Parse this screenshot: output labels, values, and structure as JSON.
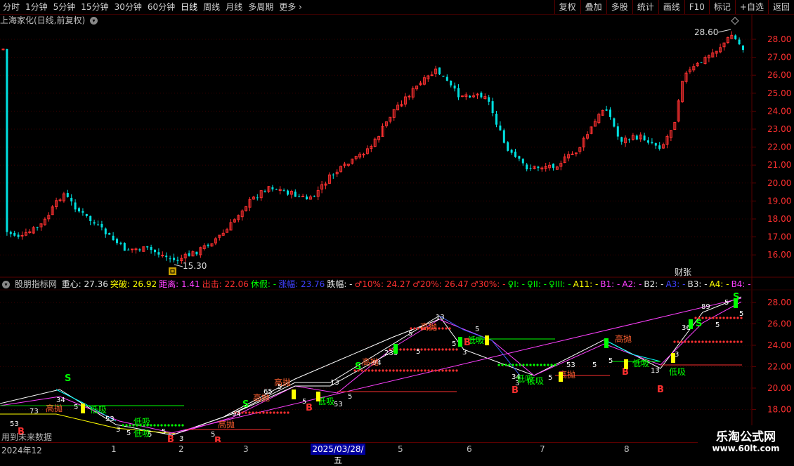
{
  "toolbar": {
    "periods": [
      "分时",
      "1分钟",
      "5分钟",
      "15分钟",
      "30分钟",
      "60分钟",
      "日线",
      "周线",
      "月线",
      "多周期",
      "更多"
    ],
    "active_period": "日线",
    "actions": [
      "复权",
      "叠加",
      "多股",
      "统计",
      "画线",
      "F10",
      "标记",
      "+自选",
      "返回"
    ]
  },
  "main_chart": {
    "title": "上海家化(日线,前复权)",
    "high_label": "28.60",
    "low_label": "15.30",
    "event_badge": "财张",
    "y_ticks": [
      "28.00",
      "27.00",
      "26.00",
      "25.00",
      "24.00",
      "23.00",
      "22.00",
      "21.00",
      "20.00",
      "19.00",
      "18.00",
      "17.00",
      "16.00"
    ]
  },
  "indicator": {
    "name": "股朋指标网",
    "fields": [
      {
        "label": "重心:",
        "value": "27.36",
        "color": "#e0e0e0"
      },
      {
        "label": "突破:",
        "value": "26.92",
        "color": "#ffff00"
      },
      {
        "label": "距离:",
        "value": "1.41",
        "color": "#ff40ff"
      },
      {
        "label": "出击:",
        "value": "22.06",
        "color": "#ff3030"
      },
      {
        "label": "休假:",
        "value": "-",
        "color": "#00ff00"
      },
      {
        "label": "涨幅:",
        "value": "23.76",
        "color": "#4040ff"
      },
      {
        "label": "跌幅:",
        "value": "-",
        "color": "#e0e0e0"
      },
      {
        "label": "♂10%:",
        "value": "24.27",
        "color": "#ff3030"
      },
      {
        "label": "♂20%:",
        "value": "26.47",
        "color": "#ff3030"
      },
      {
        "label": "♂30%:",
        "value": "-",
        "color": "#ff3030"
      },
      {
        "label": "♀I:",
        "value": "-",
        "color": "#00ff00"
      },
      {
        "label": "♀II:",
        "value": "-",
        "color": "#00ff00"
      },
      {
        "label": "♀III:",
        "value": "-",
        "color": "#00ff00"
      },
      {
        "label": "A11:",
        "value": "-",
        "color": "#ffff00"
      },
      {
        "label": "B1:",
        "value": "-",
        "color": "#ff40ff"
      },
      {
        "label": "A2:",
        "value": "-",
        "color": "#ff40ff"
      },
      {
        "label": "B2:",
        "value": "-",
        "color": "#e0e0e0"
      },
      {
        "label": "A3:",
        "value": "-",
        "color": "#4040ff"
      },
      {
        "label": "B3:",
        "value": "-",
        "color": "#e0e0e0"
      },
      {
        "label": "A4:",
        "value": "-",
        "color": "#ffff00"
      },
      {
        "label": "B4:",
        "value": "-",
        "color": "#ff40ff"
      }
    ],
    "y_ticks": [
      "28.00",
      "26.00",
      "24.00",
      "22.00",
      "20.00",
      "18.00"
    ],
    "labels_high": [
      "高抛",
      "高抛",
      "高抛",
      "高抛",
      "高抛",
      "高抛",
      "高抛",
      "高抛"
    ],
    "labels_low": [
      "低吸",
      "低吸",
      "低吸",
      "低吸",
      "低吸",
      "低吸",
      "低吸",
      "低吸",
      "低吸"
    ],
    "future_note": "用到未来数据"
  },
  "time_axis": {
    "labels": [
      "2024年12",
      "1",
      "2",
      "3",
      "2025/03/28/五",
      "5",
      "6",
      "7",
      "8"
    ]
  },
  "watermark": {
    "line1": "乐淘公式网",
    "line2": "www.60lt.com"
  },
  "colors": {
    "up": "#ff3030",
    "down": "#00e0e0",
    "grid": "#5a0000"
  }
}
